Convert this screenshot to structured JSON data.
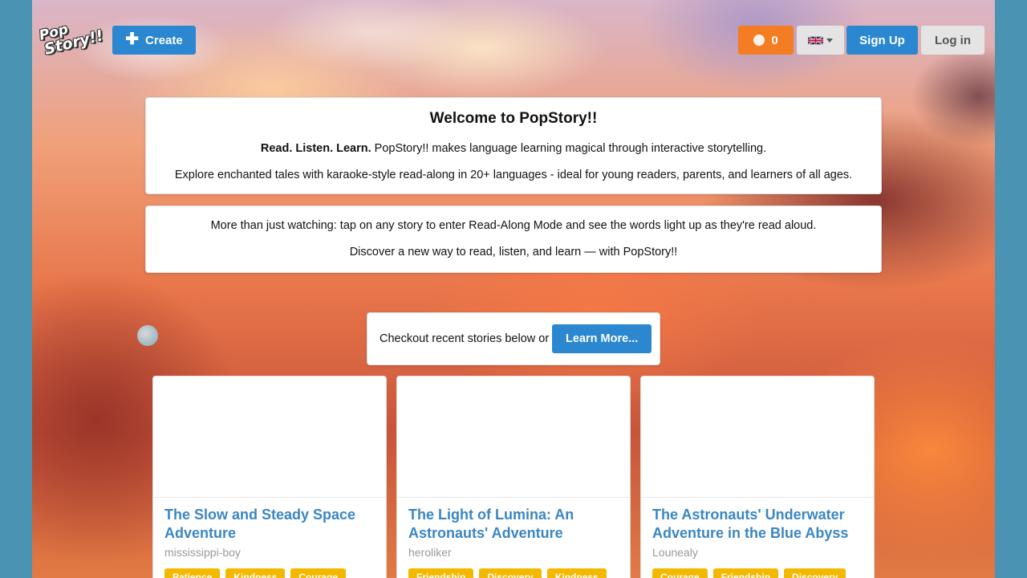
{
  "header": {
    "logo_line1": "Pop",
    "logo_line2": "Story!!",
    "create_label": "Create",
    "coins_count": "0",
    "language_icon": "uk-flag-icon",
    "signup_label": "Sign Up",
    "login_label": "Log in"
  },
  "welcome": {
    "title": "Welcome to PopStory!!",
    "tagline_bold": "Read. Listen. Learn.",
    "tagline_rest": " PopStory!! makes language learning magical through interactive storytelling.",
    "explore_text": "Explore enchanted tales with karaoke-style read-along in 20+ languages - ideal for young readers, parents, and learners of all ages."
  },
  "more": {
    "line1": "More than just watching: tap on any story to enter Read-Along Mode and see the words light up as they're read aloud.",
    "line2": "Discover a new way to read, listen, and learn — with PopStory!!"
  },
  "checkout": {
    "text": "Checkout recent stories below or",
    "learn_more_label": "Learn More..."
  },
  "stories": [
    {
      "title": "The Slow and Steady Space Adventure",
      "author": "mississippi-boy",
      "tags": [
        "Patience",
        "Kindness",
        "Courage"
      ]
    },
    {
      "title": "The Light of Lumina: An Astronauts' Adventure",
      "author": "heroliker",
      "tags": [
        "Friendship",
        "Discovery",
        "Kindness"
      ]
    },
    {
      "title": "The Astronauts' Underwater Adventure in the Blue Abyss",
      "author": "Lounealy",
      "tags": [
        "Courage",
        "Friendship",
        "Discovery"
      ]
    }
  ],
  "colors": {
    "primary": "#2a87d0",
    "coins": "#f47c22",
    "tag": "#f3b800",
    "story_title": "#3a86c3",
    "page_background": "#4a93b3"
  }
}
